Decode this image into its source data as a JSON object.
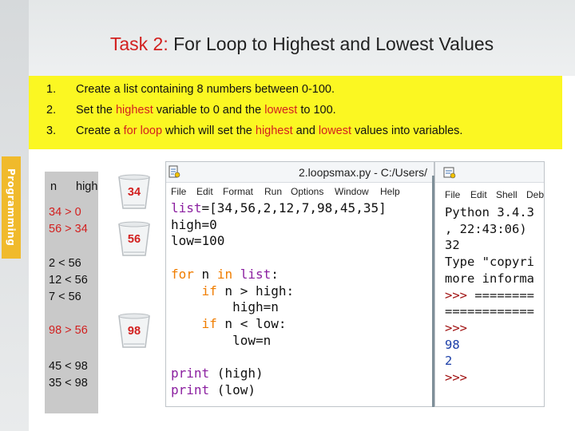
{
  "slide": {
    "title_prefix": "Task 2:",
    "title_rest": " For Loop to Highest and Lowest Values",
    "side_label": "Programming",
    "colors": {
      "accent_red": "#d2201f",
      "highlight_yellow": "#fbf722",
      "side_orange": "#f0ba2c",
      "keyword_orange": "#f07d00",
      "builtin_purple": "#8b1fa0"
    }
  },
  "tasks": [
    {
      "num": "1.",
      "parts": [
        {
          "text": "Create a list containing 8 numbers between 0-100.",
          "red": false
        }
      ]
    },
    {
      "num": "2.",
      "parts": [
        {
          "text": "Set the ",
          "red": false
        },
        {
          "text": "highest",
          "red": true
        },
        {
          "text": " variable to 0 and the ",
          "red": false
        },
        {
          "text": "lowest",
          "red": true
        },
        {
          "text": " to 100.",
          "red": false
        }
      ]
    },
    {
      "num": "3.",
      "parts": [
        {
          "text": "Create a ",
          "red": false
        },
        {
          "text": "for loop",
          "red": true
        },
        {
          "text": " which will set the ",
          "red": false
        },
        {
          "text": "highest",
          "red": true
        },
        {
          "text": " and ",
          "red": false
        },
        {
          "text": "lowest",
          "red": true
        },
        {
          "text": " values into variables.",
          "red": false
        }
      ]
    }
  ],
  "worksheet": {
    "header_n": "n",
    "header_high": "high",
    "line_1a": "34 > 0",
    "line_1b": "56 > 34",
    "line_2a": "2 < 56",
    "line_2b": "12 < 56",
    "line_2c": "7 < 56",
    "line_3": "98 > 56",
    "line_4a": "45 < 98",
    "line_4b": "35 < 98",
    "cups": [
      "34",
      "56",
      "98"
    ]
  },
  "editor": {
    "icon": "python-file-icon",
    "title": "2.loopsmax.py - C:/Users/",
    "menu": [
      "File",
      "Edit",
      "Format",
      "Run",
      "Options",
      "Window",
      "Help"
    ],
    "code": {
      "l1_name": "list",
      "l1_rest": "=[34,56,2,12,7,98,45,35]",
      "l2": "high=0",
      "l3": "low=100",
      "l5_kw1": "for",
      "l5_mid": " n ",
      "l5_kw2": "in",
      "l5_name": " list",
      "l5_end": ":",
      "l6_kw": "if",
      "l6_rest": " n > high:",
      "l7": "high=n",
      "l8_kw": "if",
      "l8_rest": " n < low:",
      "l9": "low=n",
      "l11_name": "print",
      "l11_rest": " (high)",
      "l12_name": "print",
      "l12_rest": " (low)"
    }
  },
  "shell": {
    "icon": "python-shell-icon",
    "menu": [
      "File",
      "Edit",
      "Shell",
      "Deb"
    ],
    "lines": {
      "l1": "Python 3.4.3",
      "l2": ", 22:43:06)",
      "l3": "32",
      "l4": "Type \"copyri",
      "l5": "more informa",
      "l6_prompt": ">>>",
      "l6_rest": " ========",
      "l7": "============",
      "l8_prompt": ">>>",
      "l9_out": "98",
      "l10_out": "2",
      "l11_prompt": ">>>"
    }
  }
}
